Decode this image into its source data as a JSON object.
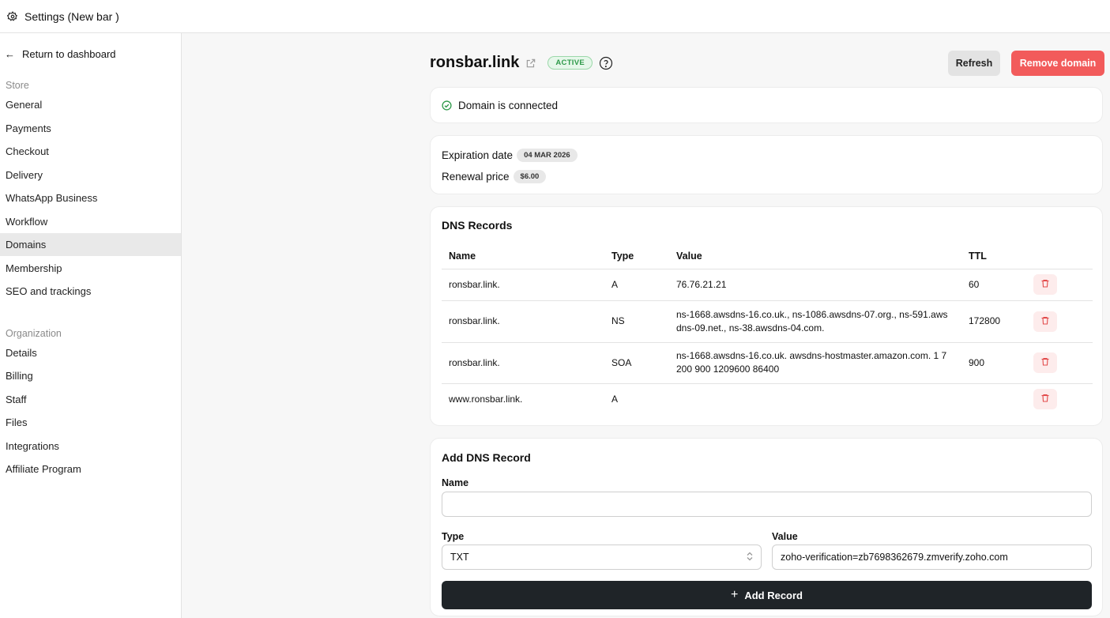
{
  "window": {
    "title": "Settings (New bar )"
  },
  "sidebar": {
    "back_label": "Return to dashboard",
    "store_label": "Store",
    "store_items": [
      {
        "label": "General"
      },
      {
        "label": "Payments"
      },
      {
        "label": "Checkout"
      },
      {
        "label": "Delivery"
      },
      {
        "label": "WhatsApp Business"
      },
      {
        "label": "Workflow"
      },
      {
        "label": "Domains",
        "active": true
      },
      {
        "label": "Membership"
      },
      {
        "label": "SEO and trackings"
      }
    ],
    "org_label": "Organization",
    "org_items": [
      {
        "label": "Details"
      },
      {
        "label": "Billing"
      },
      {
        "label": "Staff"
      },
      {
        "label": "Files"
      },
      {
        "label": "Integrations"
      },
      {
        "label": "Affiliate Program"
      }
    ]
  },
  "domain": {
    "name": "ronsbar.link",
    "status": "ACTIVE",
    "refresh_label": "Refresh",
    "remove_label": "Remove domain",
    "connected_text": "Domain is connected",
    "expiration_label": "Expiration date",
    "expiration_value": "04 MAR 2026",
    "renewal_label": "Renewal price",
    "renewal_value": "$6.00"
  },
  "dns": {
    "title": "DNS Records",
    "columns": [
      "Name",
      "Type",
      "Value",
      "TTL"
    ],
    "rows": [
      {
        "name": "ronsbar.link.",
        "type": "A",
        "value": "76.76.21.21",
        "ttl": "60"
      },
      {
        "name": "ronsbar.link.",
        "type": "NS",
        "value": "ns-1668.awsdns-16.co.uk., ns-1086.awsdns-07.org., ns-591.aws dns-09.net., ns-38.awsdns-04.com.",
        "ttl": "172800"
      },
      {
        "name": "ronsbar.link.",
        "type": "SOA",
        "value": "ns-1668.awsdns-16.co.uk. awsdns-hostmaster.amazon.com. 1 7 200 900 1209600 86400",
        "ttl": "900"
      },
      {
        "name": "www.ronsbar.link.",
        "type": "A",
        "value": "",
        "ttl": ""
      }
    ]
  },
  "add_record": {
    "title": "Add DNS Record",
    "name_label": "Name",
    "name_value": "",
    "type_label": "Type",
    "type_value": "TXT",
    "value_label": "Value",
    "value_value": "zoho-verification=zb7698362679.zmverify.zoho.com",
    "button_label": "Add Record"
  },
  "colors": {
    "accent_red": "#f25b5b",
    "active_green": "#2f9a4a",
    "dark_button": "#1f2428"
  }
}
